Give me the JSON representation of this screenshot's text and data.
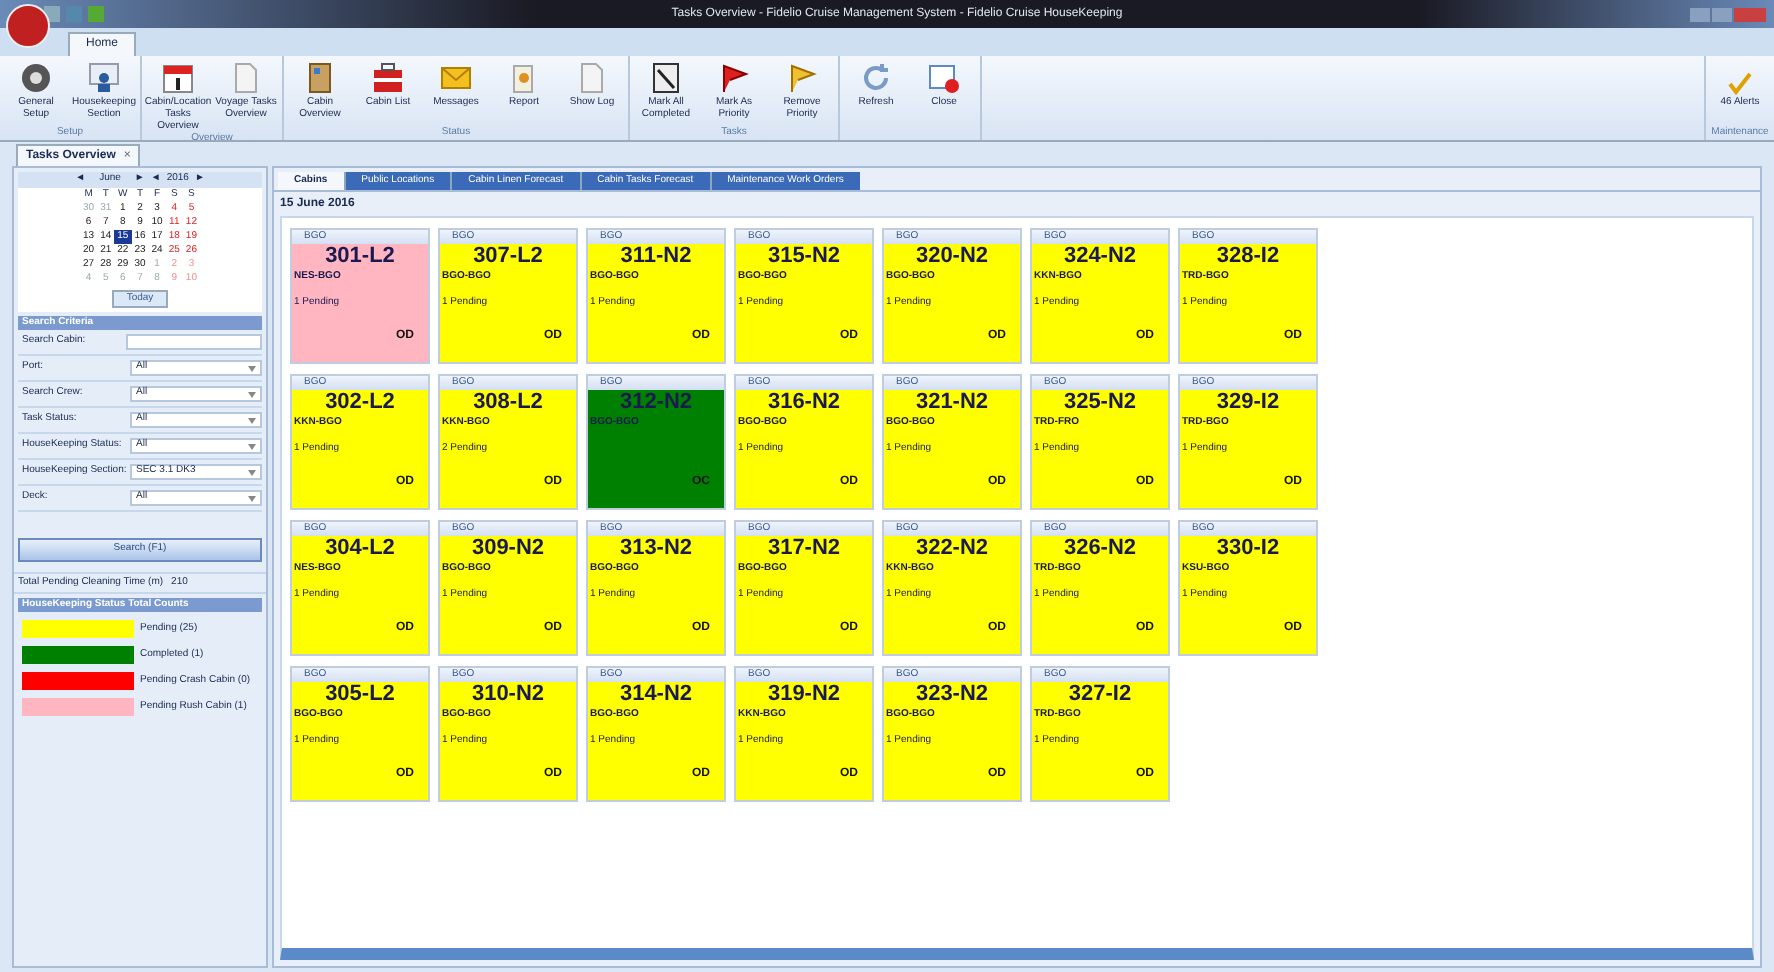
{
  "window": {
    "title": "Tasks Overview - Fidelio Cruise Management System - Fidelio Cruise HouseKeeping"
  },
  "ribbon_tabs": [
    {
      "label": "Home",
      "selected": true
    }
  ],
  "ribbon_groups": [
    {
      "label": "Setup",
      "buttons": [
        {
          "label": "General Setup",
          "kind": "gear"
        },
        {
          "label": "Housekeeping Section",
          "kind": "person"
        }
      ]
    },
    {
      "label": "Overview",
      "buttons": [
        {
          "label": "Cabin/Location Tasks Overview",
          "kind": "calendar"
        },
        {
          "label": "Voyage Tasks Overview",
          "kind": "paper"
        }
      ]
    },
    {
      "label": "Status",
      "buttons": [
        {
          "label": "Cabin Overview",
          "kind": "door"
        },
        {
          "label": "Cabin List",
          "kind": "list"
        },
        {
          "label": "Messages",
          "kind": "mail"
        },
        {
          "label": "Report",
          "kind": "report"
        },
        {
          "label": "Show Log",
          "kind": "paper"
        }
      ]
    },
    {
      "label": "Tasks",
      "buttons": [
        {
          "label": "Mark All Completed",
          "kind": "check"
        },
        {
          "label": "Mark As Priority",
          "kind": "redflag"
        },
        {
          "label": "Remove Priority",
          "kind": "yellowflag"
        }
      ]
    },
    {
      "buttons": [
        {
          "label": "Refresh",
          "kind": "refresh"
        },
        {
          "label": "Close",
          "kind": "close"
        }
      ]
    }
  ],
  "maintenance": {
    "label": "Maintenance",
    "button": "46 Alerts"
  },
  "document_tabs": [
    {
      "label": "Tasks Overview",
      "selected": true,
      "close": "×"
    }
  ],
  "calendar": {
    "prev": "◄",
    "month": "June",
    "next": "►",
    "prev_year": "◄",
    "year": "2016",
    "next_year": "►",
    "weekdays": [
      "M",
      "T",
      "W",
      "T",
      "F",
      "S",
      "S"
    ],
    "weeks": [
      [
        {
          "day": "30",
          "other": true,
          "weekend": false,
          "selected": false
        },
        {
          "day": "31",
          "other": true,
          "weekend": false,
          "selected": false
        },
        {
          "day": "1",
          "other": false,
          "weekend": false,
          "selected": false
        },
        {
          "day": "2",
          "other": false,
          "weekend": false,
          "selected": false
        },
        {
          "day": "3",
          "other": false,
          "weekend": false,
          "selected": false
        },
        {
          "day": "4",
          "other": false,
          "weekend": true,
          "selected": false
        },
        {
          "day": "5",
          "other": false,
          "weekend": true,
          "selected": false
        }
      ],
      [
        {
          "day": "6",
          "other": false,
          "weekend": false,
          "selected": false
        },
        {
          "day": "7",
          "other": false,
          "weekend": false,
          "selected": false
        },
        {
          "day": "8",
          "other": false,
          "weekend": false,
          "selected": false
        },
        {
          "day": "9",
          "other": false,
          "weekend": false,
          "selected": false
        },
        {
          "day": "10",
          "other": false,
          "weekend": false,
          "selected": false
        },
        {
          "day": "11",
          "other": false,
          "weekend": true,
          "selected": false
        },
        {
          "day": "12",
          "other": false,
          "weekend": true,
          "selected": false
        }
      ],
      [
        {
          "day": "13",
          "other": false,
          "weekend": false,
          "selected": false
        },
        {
          "day": "14",
          "other": false,
          "weekend": false,
          "selected": false
        },
        {
          "day": "15",
          "other": false,
          "weekend": false,
          "selected": true
        },
        {
          "day": "16",
          "other": false,
          "weekend": false,
          "selected": false
        },
        {
          "day": "17",
          "other": false,
          "weekend": false,
          "selected": false
        },
        {
          "day": "18",
          "other": false,
          "weekend": true,
          "selected": false
        },
        {
          "day": "19",
          "other": false,
          "weekend": true,
          "selected": false
        }
      ],
      [
        {
          "day": "20",
          "other": false,
          "weekend": false,
          "selected": false
        },
        {
          "day": "21",
          "other": false,
          "weekend": false,
          "selected": false
        },
        {
          "day": "22",
          "other": false,
          "weekend": false,
          "selected": false
        },
        {
          "day": "23",
          "other": false,
          "weekend": false,
          "selected": false
        },
        {
          "day": "24",
          "other": false,
          "weekend": false,
          "selected": false
        },
        {
          "day": "25",
          "other": false,
          "weekend": true,
          "selected": false
        },
        {
          "day": "26",
          "other": false,
          "weekend": true,
          "selected": false
        }
      ],
      [
        {
          "day": "27",
          "other": false,
          "weekend": false,
          "selected": false
        },
        {
          "day": "28",
          "other": false,
          "weekend": false,
          "selected": false
        },
        {
          "day": "29",
          "other": false,
          "weekend": false,
          "selected": false
        },
        {
          "day": "30",
          "other": false,
          "weekend": false,
          "selected": false
        },
        {
          "day": "1",
          "other": true,
          "weekend": false,
          "selected": false
        },
        {
          "day": "2",
          "other": true,
          "weekend": true,
          "selected": false
        },
        {
          "day": "3",
          "other": true,
          "weekend": true,
          "selected": false
        }
      ],
      [
        {
          "day": "4",
          "other": true,
          "weekend": false,
          "selected": false
        },
        {
          "day": "5",
          "other": true,
          "weekend": false,
          "selected": false
        },
        {
          "day": "6",
          "other": true,
          "weekend": false,
          "selected": false
        },
        {
          "day": "7",
          "other": true,
          "weekend": false,
          "selected": false
        },
        {
          "day": "8",
          "other": true,
          "weekend": false,
          "selected": false
        },
        {
          "day": "9",
          "other": true,
          "weekend": true,
          "selected": false
        },
        {
          "day": "10",
          "other": true,
          "weekend": true,
          "selected": false
        }
      ]
    ],
    "today": "Today"
  },
  "search_criteria": {
    "title": "Search Criteria",
    "fields": [
      {
        "label": "Search Cabin:",
        "kind": "text"
      },
      {
        "label": "Port:",
        "kind": "select",
        "value": "All"
      },
      {
        "label": "Search Crew:",
        "kind": "select",
        "value": "All"
      },
      {
        "label": "Task Status:",
        "kind": "select",
        "value": "All"
      },
      {
        "label": "HouseKeeping Status:",
        "kind": "select",
        "value": "All"
      },
      {
        "label": "HouseKeeping Section:",
        "kind": "select",
        "value": "SEC 3.1 DK3"
      },
      {
        "label": "Deck:",
        "kind": "select",
        "value": "All"
      }
    ],
    "button": "Search (F1)"
  },
  "total_time": {
    "label": "Total Pending Cleaning Time (m)",
    "value": "210"
  },
  "status_counts": {
    "title": "HouseKeeping Status Total Counts",
    "items": [
      {
        "label": "Pending (25)",
        "color": "#ffff00"
      },
      {
        "label": "Completed (1)",
        "color": "#008000"
      },
      {
        "label": "Pending Crash Cabin (0)",
        "color": "#ff0000"
      },
      {
        "label": "Pending Rush Cabin (1)",
        "color": "#ffb6c1"
      }
    ]
  },
  "view_tabs": [
    {
      "label": "Cabins",
      "selected": true
    },
    {
      "label": "Public Locations",
      "selected": false
    },
    {
      "label": "Cabin Linen Forecast",
      "selected": false
    },
    {
      "label": "Cabin Tasks Forecast",
      "selected": false
    },
    {
      "label": "Maintenance Work Orders",
      "selected": false
    }
  ],
  "date": "15 June 2016",
  "cabin_rows": [
    [
      {
        "port": "BGO",
        "cabin": "301-L2",
        "route": "NES-BGO",
        "pending": "1 Pending",
        "code": "OD",
        "color": "#ffb6c1"
      },
      {
        "port": "BGO",
        "cabin": "307-L2",
        "route": "BGO-BGO",
        "pending": "1 Pending",
        "code": "OD",
        "color": "#ffff00"
      },
      {
        "port": "BGO",
        "cabin": "311-N2",
        "route": "BGO-BGO",
        "pending": "1 Pending",
        "code": "OD",
        "color": "#ffff00"
      },
      {
        "port": "BGO",
        "cabin": "315-N2",
        "route": "BGO-BGO",
        "pending": "1 Pending",
        "code": "OD",
        "color": "#ffff00"
      },
      {
        "port": "BGO",
        "cabin": "320-N2",
        "route": "BGO-BGO",
        "pending": "1 Pending",
        "code": "OD",
        "color": "#ffff00"
      },
      {
        "port": "BGO",
        "cabin": "324-N2",
        "route": "KKN-BGO",
        "pending": "1 Pending",
        "code": "OD",
        "color": "#ffff00"
      },
      {
        "port": "BGO",
        "cabin": "328-I2",
        "route": "TRD-BGO",
        "pending": "1 Pending",
        "code": "OD",
        "color": "#ffff00"
      }
    ],
    [
      {
        "port": "BGO",
        "cabin": "302-L2",
        "route": "KKN-BGO",
        "pending": "1 Pending",
        "code": "OD",
        "color": "#ffff00"
      },
      {
        "port": "BGO",
        "cabin": "308-L2",
        "route": "KKN-BGO",
        "pending": "2 Pending",
        "code": "OD",
        "color": "#ffff00"
      },
      {
        "port": "BGO",
        "cabin": "312-N2",
        "route": "BGO-BGO",
        "code": "OC",
        "color": "#008000"
      },
      {
        "port": "BGO",
        "cabin": "316-N2",
        "route": "BGO-BGO",
        "pending": "1 Pending",
        "code": "OD",
        "color": "#ffff00"
      },
      {
        "port": "BGO",
        "cabin": "321-N2",
        "route": "BGO-BGO",
        "pending": "1 Pending",
        "code": "OD",
        "color": "#ffff00"
      },
      {
        "port": "BGO",
        "cabin": "325-N2",
        "route": "TRD-FRO",
        "pending": "1 Pending",
        "code": "OD",
        "color": "#ffff00"
      },
      {
        "port": "BGO",
        "cabin": "329-I2",
        "route": "TRD-BGO",
        "pending": "1 Pending",
        "code": "OD",
        "color": "#ffff00"
      }
    ],
    [
      {
        "port": "BGO",
        "cabin": "304-L2",
        "route": "NES-BGO",
        "pending": "1 Pending",
        "code": "OD",
        "color": "#ffff00"
      },
      {
        "port": "BGO",
        "cabin": "309-N2",
        "route": "BGO-BGO",
        "pending": "1 Pending",
        "code": "OD",
        "color": "#ffff00"
      },
      {
        "port": "BGO",
        "cabin": "313-N2",
        "route": "BGO-BGO",
        "pending": "1 Pending",
        "code": "OD",
        "color": "#ffff00"
      },
      {
        "port": "BGO",
        "cabin": "317-N2",
        "route": "BGO-BGO",
        "pending": "1 Pending",
        "code": "OD",
        "color": "#ffff00"
      },
      {
        "port": "BGO",
        "cabin": "322-N2",
        "route": "KKN-BGO",
        "pending": "1 Pending",
        "code": "OD",
        "color": "#ffff00"
      },
      {
        "port": "BGO",
        "cabin": "326-N2",
        "route": "TRD-BGO",
        "pending": "1 Pending",
        "code": "OD",
        "color": "#ffff00"
      },
      {
        "port": "BGO",
        "cabin": "330-I2",
        "route": "KSU-BGO",
        "pending": "1 Pending",
        "code": "OD",
        "color": "#ffff00"
      }
    ],
    [
      {
        "port": "BGO",
        "cabin": "305-L2",
        "route": "BGO-BGO",
        "pending": "1 Pending",
        "code": "OD",
        "color": "#ffff00"
      },
      {
        "port": "BGO",
        "cabin": "310-N2",
        "route": "BGO-BGO",
        "pending": "1 Pending",
        "code": "OD",
        "color": "#ffff00"
      },
      {
        "port": "BGO",
        "cabin": "314-N2",
        "route": "BGO-BGO",
        "pending": "1 Pending",
        "code": "OD",
        "color": "#ffff00"
      },
      {
        "port": "BGO",
        "cabin": "319-N2",
        "route": "KKN-BGO",
        "pending": "1 Pending",
        "code": "OD",
        "color": "#ffff00"
      },
      {
        "port": "BGO",
        "cabin": "323-N2",
        "route": "BGO-BGO",
        "pending": "1 Pending",
        "code": "OD",
        "color": "#ffff00"
      },
      {
        "port": "BGO",
        "cabin": "327-I2",
        "route": "TRD-BGO",
        "pending": "1 Pending",
        "code": "OD",
        "color": "#ffff00"
      }
    ]
  ]
}
